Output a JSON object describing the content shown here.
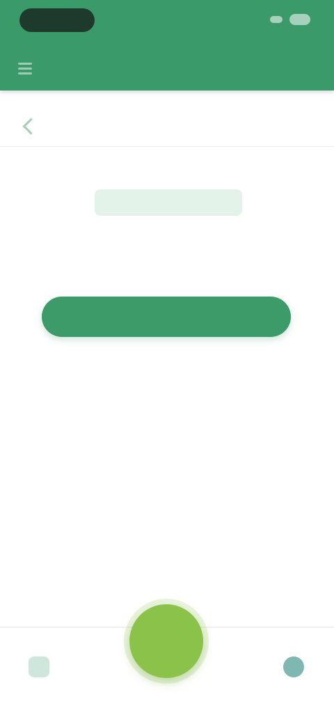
{
  "colors": {
    "header_background": "#3a9a6a",
    "primary_button": "#3d9a69",
    "fab": "#8bc34a",
    "background": "#ffffff"
  },
  "status_bar": {
    "icons": [
      "status-pill",
      "signal-icon",
      "battery-icon"
    ]
  },
  "toolbar": {
    "menu_icon": "menu-icon",
    "title": ""
  },
  "subheader": {
    "back_icon": "back-icon",
    "label": ""
  },
  "empty_state": {
    "title": "",
    "description": "",
    "button_label": ""
  },
  "bottom_nav": {
    "left": {
      "icon": "home-icon",
      "label": ""
    },
    "fab": {
      "icon": "add-icon",
      "label": ""
    },
    "right": {
      "icon": "profile-icon",
      "label": ""
    }
  }
}
